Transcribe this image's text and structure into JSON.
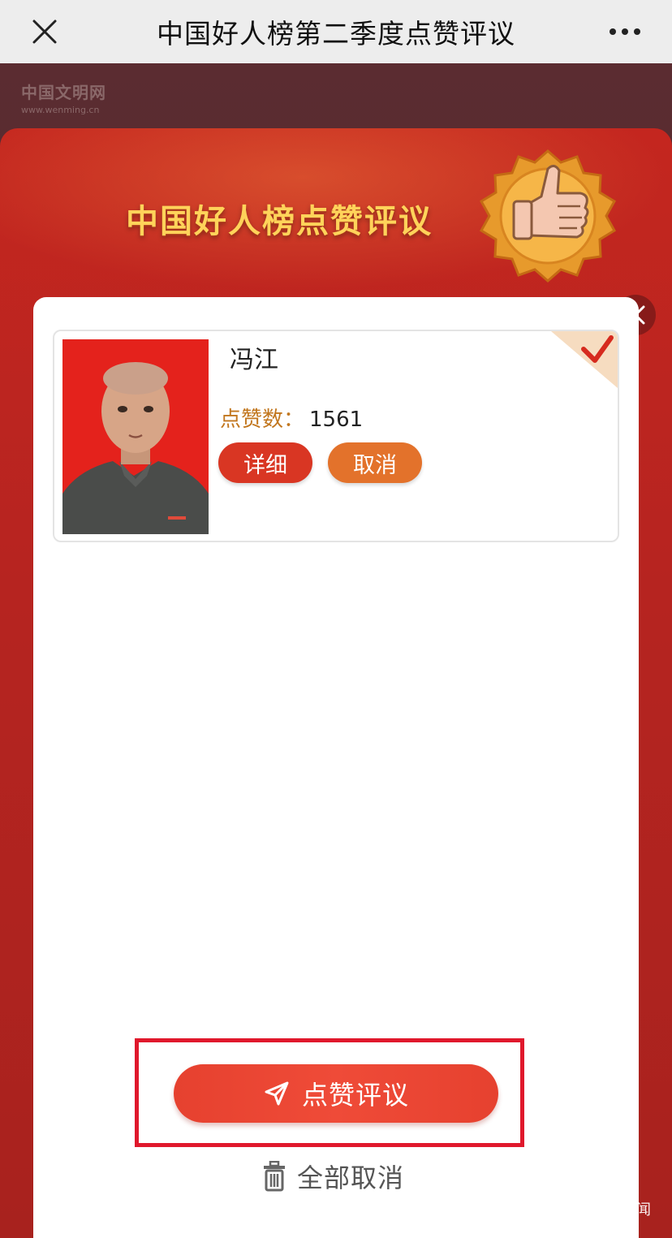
{
  "navbar": {
    "title": "中国好人榜第二季度点赞评议",
    "close_icon": "close-icon",
    "more_icon": "more-dots-icon"
  },
  "site_logo": {
    "name": "中国文明网",
    "url": "www.wenming.cn"
  },
  "modal": {
    "title": "中国好人榜点赞评议",
    "badge_icon": "thumbs-up-icon",
    "close_icon": "close-icon"
  },
  "candidate": {
    "name": "冯江",
    "likes_label": "点赞数：",
    "likes": "1561",
    "detail_label": "详细",
    "cancel_label": "取消",
    "selected": true,
    "selected_icon": "checkmark-icon"
  },
  "actions": {
    "submit_label": "点赞评议",
    "submit_icon": "send-icon",
    "clear_label": "全部取消",
    "clear_icon": "trash-icon"
  },
  "watermark": {
    "text": "蔡甸新闻"
  },
  "colors": {
    "modal_red": "#c4261f",
    "title_gold": "#ffd35a",
    "detail_button": "#d93623",
    "cancel_button": "#e3722b",
    "submit_button": "#ef4b38",
    "highlight_border": "#e0182c"
  }
}
